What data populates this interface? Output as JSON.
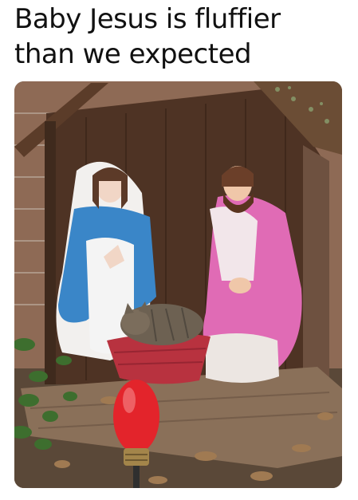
{
  "meme": {
    "caption_line1": "Baby Jesus is fluffier",
    "caption_line2": "than we expected"
  },
  "colors": {
    "background": "#ffffff",
    "text": "#111111",
    "mary_robe": "#3a86c8",
    "joseph_robe": "#e06bb5",
    "basket": "#b8323f",
    "bulb": "#e3242b",
    "stable_wood": "#5a3b28"
  }
}
